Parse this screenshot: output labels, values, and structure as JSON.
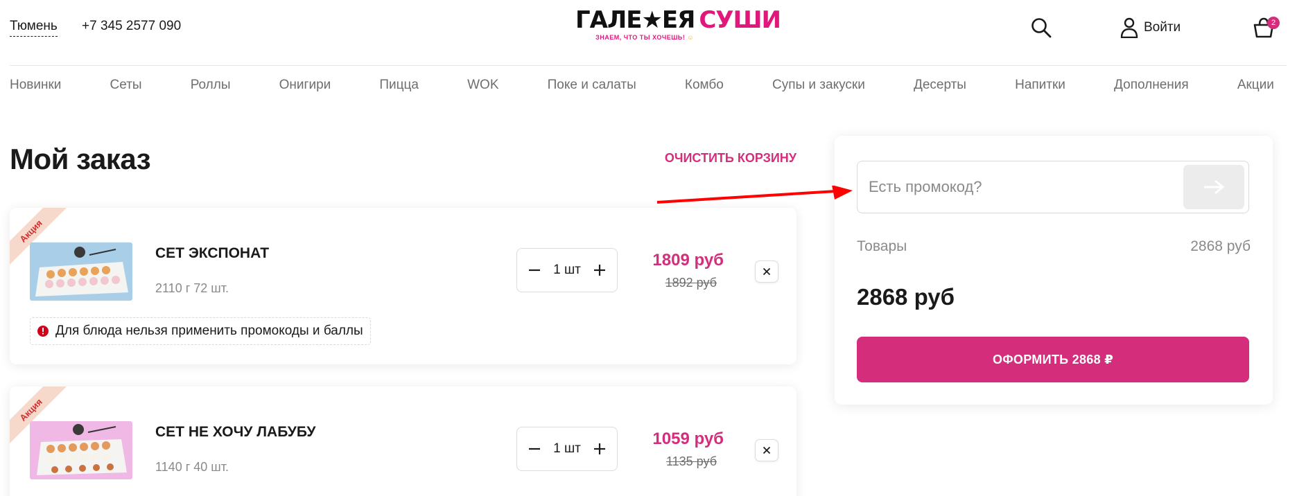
{
  "header": {
    "city": "Тюмень",
    "phone": "+7 345 2577 090",
    "logo_left": "ГАЛЕ★ЕЯ",
    "logo_right": "СУШИ",
    "logo_tagline": "ЗНАЕМ, ЧТО ТЫ ХОЧЕШЬ!",
    "login_label": "Войти",
    "cart_count": "2"
  },
  "nav": {
    "items": [
      "Новинки",
      "Сеты",
      "Роллы",
      "Онигири",
      "Пицца",
      "WOK",
      "Поке и салаты",
      "Комбо",
      "Супы и закуски",
      "Десерты",
      "Напитки",
      "Дополнения",
      "Акции"
    ]
  },
  "order": {
    "title": "Мой заказ",
    "clear_label": "ОЧИСТИТЬ КОРЗИНУ",
    "items": [
      {
        "badge": "Акция",
        "name": "СЕТ ЭКСПОНАТ",
        "weight": "2110 г 72 шт.",
        "qty": "1 шт",
        "price": "1809 руб",
        "old_price": "1892 руб",
        "notice": "Для блюда нельзя применить промокоды и баллы",
        "thumb_bg": "#a9cfe8"
      },
      {
        "badge": "Акция",
        "name": "СЕТ НЕ ХОЧУ ЛАБУБУ",
        "weight": "1140 г 40 шт.",
        "qty": "1 шт",
        "price": "1059 руб",
        "old_price": "1135 руб",
        "thumb_bg": "#f0b8e4"
      }
    ]
  },
  "summary": {
    "promo_placeholder": "Есть промокод?",
    "goods_label": "Товары",
    "goods_value": "2868 руб",
    "total": "2868 руб",
    "checkout_label": "ОФОРМИТЬ 2868 ₽"
  },
  "colors": {
    "accent": "#d42d7c",
    "ribbon": "#f7d9cc",
    "annotation_arrow": "#ff0000"
  }
}
